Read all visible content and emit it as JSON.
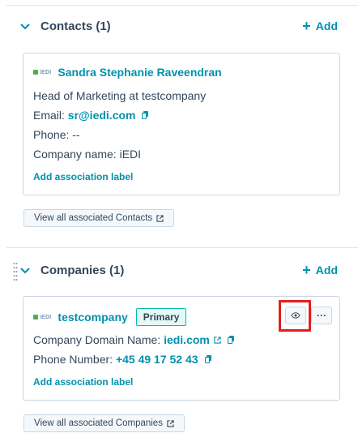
{
  "contacts": {
    "header": "Contacts (1)",
    "add_label": "Add",
    "card": {
      "logo_text": "iEDI",
      "name": "Sandra Stephanie Raveendran",
      "job": "Head of Marketing at testcompany",
      "email_label": "Email:",
      "email_value": "sr@iedi.com",
      "phone_text": "Phone: --",
      "company_text": "Company name: iEDI",
      "assoc_label": "Add association label"
    },
    "view_all": "View all associated Contacts"
  },
  "companies": {
    "header": "Companies (1)",
    "add_label": "Add",
    "card": {
      "logo_text": "iEDI",
      "name": "testcompany",
      "badge": "Primary",
      "domain_label": "Company Domain Name:",
      "domain_value": "iedi.com",
      "phone_label": "Phone Number:",
      "phone_value": "+45 49 17 52 43",
      "assoc_label": "Add association label",
      "more_label": "···"
    },
    "view_all": "View all associated Companies"
  },
  "colors": {
    "accent": "#0091ae",
    "highlight": "#e0201c",
    "badge_border": "#00bda5"
  }
}
